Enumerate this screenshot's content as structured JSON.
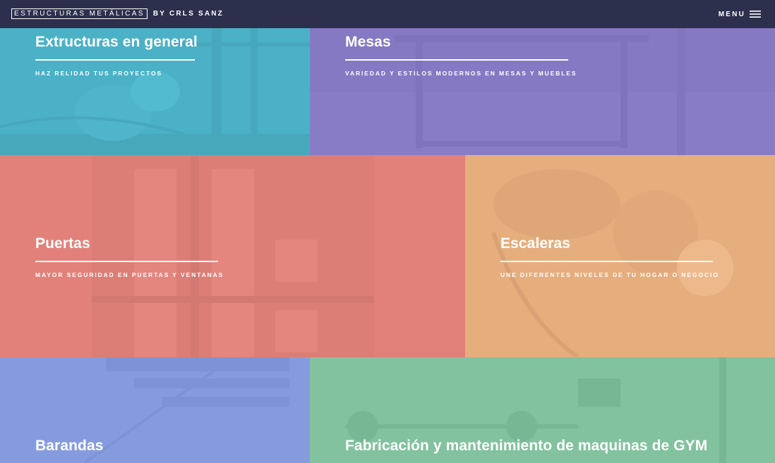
{
  "header": {
    "logo_box": "ESTRUCTURAS METÁLICAS",
    "logo_by": "BY CRLS SANZ",
    "menu_label": "MENU",
    "menu_icon": "hamburger-icon"
  },
  "tiles": [
    {
      "title": "Extructuras en general",
      "subtitle": "HAZ RELIDAD TUS PROYECTOS",
      "color": "#5cbfd2"
    },
    {
      "title": "Mesas",
      "subtitle": "VARIEDAD Y ESTILOS MODERNOS EN MESAS Y MUEBLES",
      "color": "#8d80c9"
    },
    {
      "title": "Puertas",
      "subtitle": "MAYOR SEGURIDAD EN PUERTAS Y VENTANAS",
      "color": "#e58a84"
    },
    {
      "title": "Escaleras",
      "subtitle": "UNE DIFERENTES NIVELES DE TU HOGAR O NEGOCIO",
      "color": "#e9b386"
    },
    {
      "title": "Barandas",
      "color": "#8ea1e0"
    },
    {
      "title": "Fabricación y mantenimiento de maquinas de GYM",
      "color": "#8ac6a4"
    }
  ]
}
